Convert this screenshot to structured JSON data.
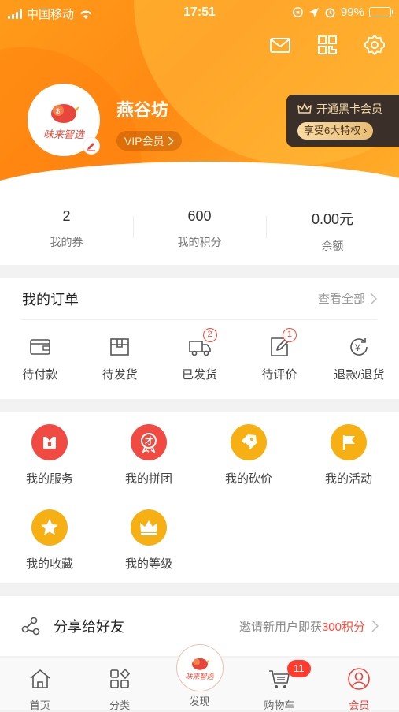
{
  "status_bar": {
    "carrier": "中国移动",
    "time": "17:51",
    "battery": "99%",
    "battery_level": 0.99
  },
  "profile": {
    "name": "燕谷坊",
    "avatar_logo_text": "味来智选",
    "vip_label": "VIP会员",
    "black_card": {
      "title": "开通黑卡会员",
      "benefit": "享受6大特权"
    }
  },
  "stats": [
    {
      "value": "2",
      "label": "我的券"
    },
    {
      "value": "600",
      "label": "我的积分"
    },
    {
      "value": "0.00元",
      "label": "余额"
    }
  ],
  "orders": {
    "title": "我的订单",
    "view_all": "查看全部",
    "items": [
      {
        "label": "待付款",
        "icon": "wallet-icon",
        "badge": ""
      },
      {
        "label": "待发货",
        "icon": "package-icon",
        "badge": ""
      },
      {
        "label": "已发货",
        "icon": "truck-icon",
        "badge": "2"
      },
      {
        "label": "待评价",
        "icon": "edit-review-icon",
        "badge": "1"
      },
      {
        "label": "退款/退货",
        "icon": "refund-icon",
        "badge": ""
      }
    ]
  },
  "services": [
    {
      "label": "我的服务",
      "icon": "service-icon",
      "color": "#f04a42"
    },
    {
      "label": "我的拼团",
      "icon": "group-buy-icon",
      "color": "#f04a42"
    },
    {
      "label": "我的砍价",
      "icon": "bargain-icon",
      "color": "#f7b014"
    },
    {
      "label": "我的活动",
      "icon": "flag-icon",
      "color": "#f7b014"
    },
    {
      "label": "我的收藏",
      "icon": "star-icon",
      "color": "#f7b014"
    },
    {
      "label": "我的等级",
      "icon": "crown-icon",
      "color": "#f7b014"
    }
  ],
  "share": {
    "title": "分享给好友",
    "invite_prefix": "邀请新用户即获",
    "invite_points": "300积分"
  },
  "tabbar": {
    "items": [
      {
        "label": "首页",
        "icon": "home-icon"
      },
      {
        "label": "分类",
        "icon": "category-icon"
      },
      {
        "label": "发现",
        "icon": "discover-logo-icon",
        "logo_text": "味来智选"
      },
      {
        "label": "购物车",
        "icon": "cart-icon",
        "badge": "11"
      },
      {
        "label": "会员",
        "icon": "member-icon"
      }
    ],
    "active": "会员"
  },
  "colors": {
    "brand_orange": "#ff8a14",
    "accent_red": "#e8453c",
    "gold": "#f7b014"
  }
}
